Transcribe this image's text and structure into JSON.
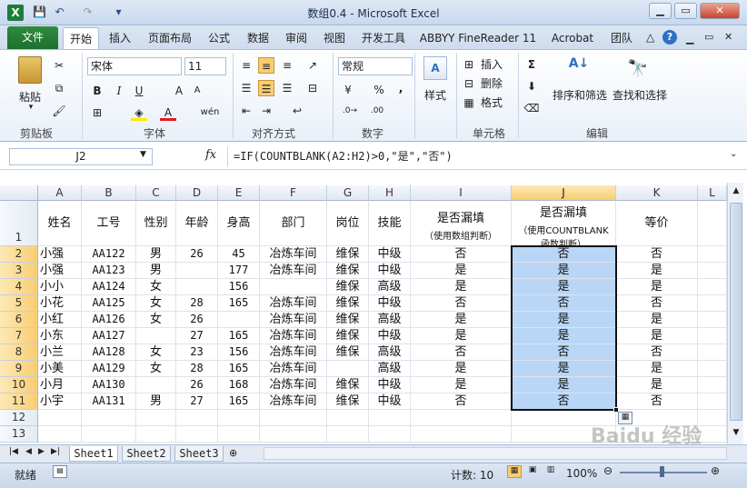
{
  "window": {
    "title": "数组0.4 - Microsoft Excel"
  },
  "qat": {
    "save": "💾",
    "undo": "↶",
    "redo": "↷",
    "more": "▾"
  },
  "tabs": [
    "文件",
    "开始",
    "插入",
    "页面布局",
    "公式",
    "数据",
    "审阅",
    "视图",
    "开发工具",
    "ABBYY FineReader 11",
    "Acrobat",
    "团队"
  ],
  "ribbon": {
    "paste": "粘贴",
    "clipboard": "剪贴板",
    "font_name": "宋体",
    "font_size": "11",
    "font_group": "字体",
    "align_group": "对齐方式",
    "num_format": "常规",
    "number_group": "数字",
    "styles": "样式",
    "insert": "插入",
    "delete": "删除",
    "format": "格式",
    "cells_group": "单元格",
    "sort_filter": "排序和筛选",
    "find_select": "查找和选择",
    "edit_group": "编辑",
    "bold": "B",
    "italic": "I",
    "underline": "U",
    "percent": "%",
    "comma": ","
  },
  "formula_bar": {
    "name_box": "J2",
    "fx": "fx",
    "formula": "=IF(COUNTBLANK(A2:H2)>0,\"是\",\"否\")"
  },
  "columns": [
    "A",
    "B",
    "C",
    "D",
    "E",
    "F",
    "G",
    "H",
    "I",
    "J",
    "K",
    "L"
  ],
  "headers": {
    "A": "姓名",
    "B": "工号",
    "C": "性别",
    "D": "年龄",
    "E": "身高",
    "F": "部门",
    "G": "岗位",
    "H": "技能",
    "I_1": "是否漏填",
    "I_2": "（使用数组判断）",
    "J_1": "是否漏填",
    "J_2": "（使用COUNTBLANK",
    "J_3": "函数判断）",
    "K": "等价"
  },
  "rows": [
    [
      "小强",
      "AA122",
      "男",
      "26",
      "45",
      "冶炼车间",
      "维保",
      "中级",
      "否",
      "否",
      "否"
    ],
    [
      "小强",
      "AA123",
      "男",
      "",
      "177",
      "冶炼车间",
      "维保",
      "中级",
      "是",
      "是",
      "是"
    ],
    [
      "小小",
      "AA124",
      "女",
      "",
      "156",
      "",
      "维保",
      "高级",
      "是",
      "是",
      "是"
    ],
    [
      "小花",
      "AA125",
      "女",
      "28",
      "165",
      "冶炼车间",
      "维保",
      "中级",
      "否",
      "否",
      "否"
    ],
    [
      "小红",
      "AA126",
      "女",
      "26",
      "",
      "冶炼车间",
      "维保",
      "高级",
      "是",
      "是",
      "是"
    ],
    [
      "小东",
      "AA127",
      "",
      "27",
      "165",
      "冶炼车间",
      "维保",
      "中级",
      "是",
      "是",
      "是"
    ],
    [
      "小兰",
      "AA128",
      "女",
      "23",
      "156",
      "冶炼车间",
      "维保",
      "高级",
      "否",
      "否",
      "否"
    ],
    [
      "小美",
      "AA129",
      "女",
      "28",
      "165",
      "冶炼车间",
      "",
      "高级",
      "是",
      "是",
      "是"
    ],
    [
      "小月",
      "AA130",
      "",
      "26",
      "168",
      "冶炼车间",
      "维保",
      "中级",
      "是",
      "是",
      "是"
    ],
    [
      "小宇",
      "AA131",
      "男",
      "27",
      "165",
      "冶炼车间",
      "维保",
      "中级",
      "否",
      "否",
      "否"
    ]
  ],
  "row_numbers": [
    "1",
    "2",
    "3",
    "4",
    "5",
    "6",
    "7",
    "8",
    "9",
    "10",
    "11",
    "12",
    "13"
  ],
  "sheets": [
    "Sheet1",
    "Sheet2",
    "Sheet3"
  ],
  "status": {
    "ready": "就绪",
    "count": "计数: 10",
    "zoom": "100%"
  },
  "watermark": "Baidu 经验"
}
